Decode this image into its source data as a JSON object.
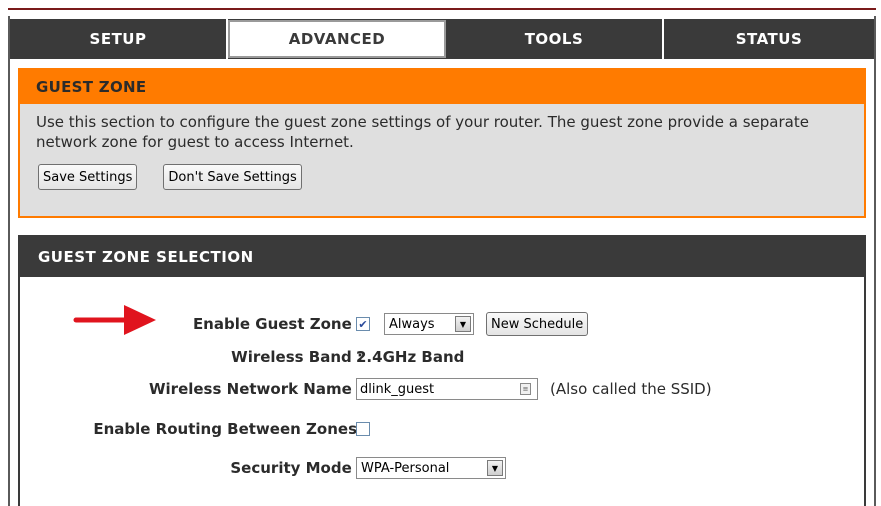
{
  "tabs": [
    {
      "label": "SETUP",
      "active": false
    },
    {
      "label": "ADVANCED",
      "active": true
    },
    {
      "label": "TOOLS",
      "active": false
    },
    {
      "label": "STATUS",
      "active": false
    }
  ],
  "guest_zone": {
    "title": "GUEST ZONE",
    "description": "Use this section to configure the guest zone settings of your router. The guest zone provide a separate network zone for guest to access Internet.",
    "save_button": "Save Settings",
    "dont_save_button": "Don't Save Settings"
  },
  "selection": {
    "title": "GUEST ZONE SELECTION",
    "enable_guest_zone": {
      "label": "Enable Guest Zone :",
      "checked": true,
      "schedule_value": "Always",
      "new_schedule_button": "New Schedule"
    },
    "wireless_band": {
      "label": "Wireless Band :",
      "value": "2.4GHz Band"
    },
    "wireless_network_name": {
      "label": "Wireless Network Name :",
      "value": "dlink_guest",
      "note": "(Also called the SSID)"
    },
    "enable_routing": {
      "label": "Enable Routing Between Zones:",
      "checked": false
    },
    "security_mode": {
      "label": "Security Mode :",
      "value": "WPA-Personal"
    }
  },
  "colors": {
    "accent_orange": "#ff7b00",
    "header_dark": "#3a3a3a",
    "arrow_red": "#e0141e"
  }
}
